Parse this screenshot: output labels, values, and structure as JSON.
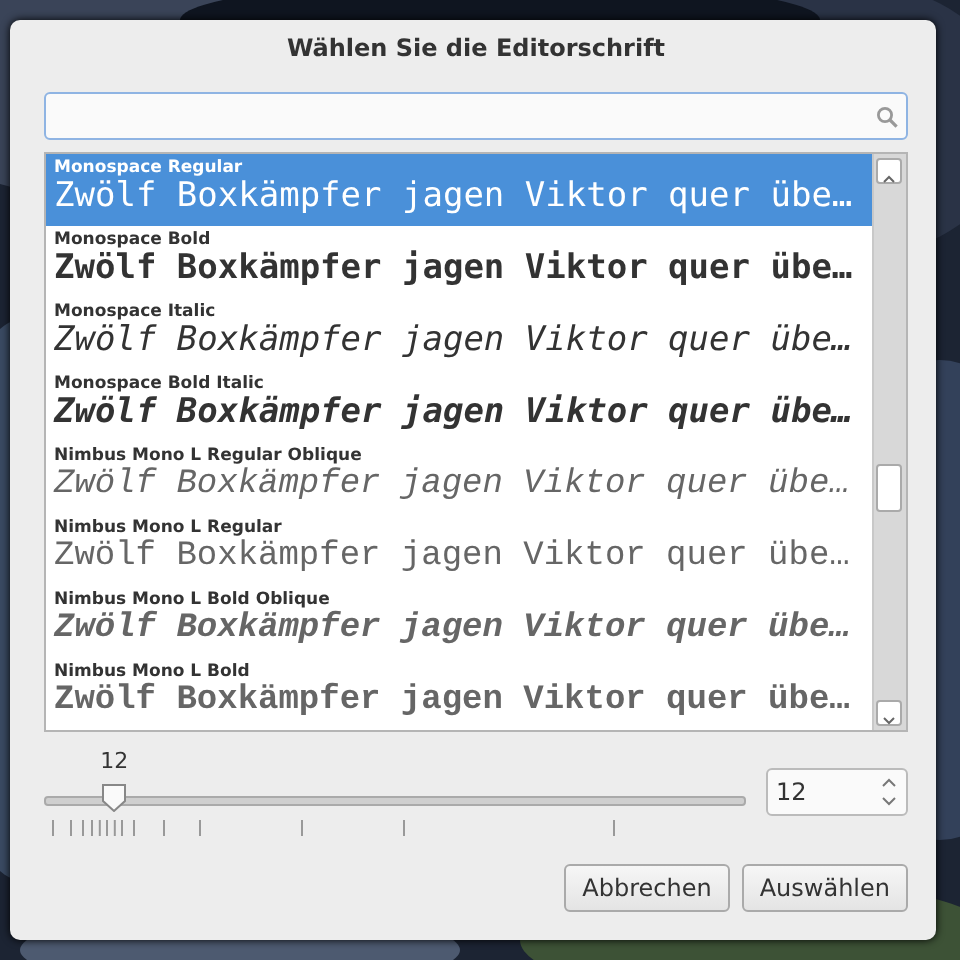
{
  "dialog": {
    "title": "Wählen Sie die Editorschrift",
    "fonts": [
      {
        "name": "Monospace Regular",
        "sample": "Zwölf Boxkämpfer jagen Viktor quer übe…",
        "kind": "sans",
        "bold": false,
        "italic": false,
        "selected": true
      },
      {
        "name": "Monospace Bold",
        "sample": "Zwölf Boxkämpfer jagen Viktor quer übe…",
        "kind": "sans",
        "bold": true,
        "italic": false,
        "selected": false
      },
      {
        "name": "Monospace Italic",
        "sample": "Zwölf Boxkämpfer jagen Viktor quer übe…",
        "kind": "sans",
        "bold": false,
        "italic": true,
        "selected": false
      },
      {
        "name": "Monospace Bold Italic",
        "sample": "Zwölf Boxkämpfer jagen Viktor quer übe…",
        "kind": "sans",
        "bold": true,
        "italic": true,
        "selected": false
      },
      {
        "name": "Nimbus Mono L Regular Oblique",
        "sample": "Zwölf Boxkämpfer jagen Viktor quer übe…",
        "kind": "typewriter",
        "bold": false,
        "italic": true,
        "selected": false
      },
      {
        "name": "Nimbus Mono L Regular",
        "sample": "Zwölf Boxkämpfer jagen Viktor quer übe…",
        "kind": "typewriter",
        "bold": false,
        "italic": false,
        "selected": false
      },
      {
        "name": "Nimbus Mono L Bold Oblique",
        "sample": "Zwölf Boxkämpfer jagen Viktor quer übe…",
        "kind": "typewriter",
        "bold": true,
        "italic": true,
        "selected": false
      },
      {
        "name": "Nimbus Mono L Bold",
        "sample": "Zwölf Boxkämpfer jagen Viktor quer übe…",
        "kind": "typewriter",
        "bold": true,
        "italic": false,
        "selected": false
      }
    ],
    "size_slider": {
      "reading": "12",
      "level": 0.1
    },
    "size_field": {
      "value": "12"
    },
    "buttons": [
      "Abbrechen",
      "Auswählen"
    ]
  }
}
